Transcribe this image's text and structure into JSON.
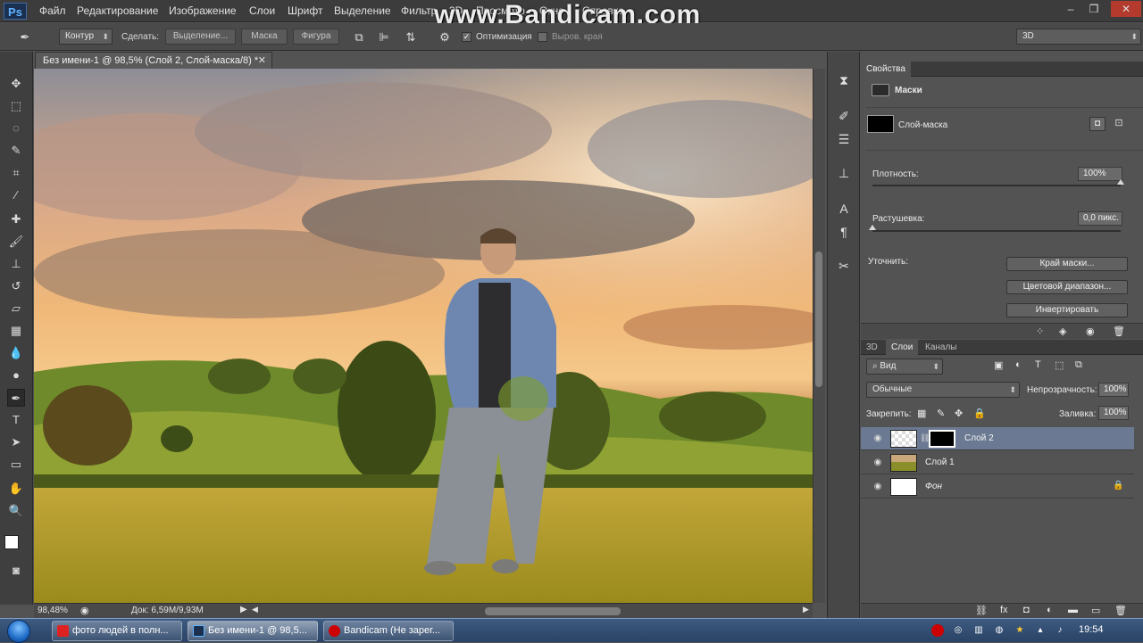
{
  "menubar": {
    "logo": "Ps",
    "items": [
      "Файл",
      "Редактирование",
      "Изображение",
      "Слои",
      "Шрифт",
      "Выделение",
      "Фильтр",
      "3D",
      "Просмотр",
      "Окно",
      "Справка"
    ],
    "watermark": "www.Bandicam.com",
    "window_controls": [
      "–",
      "❐",
      "✕"
    ]
  },
  "options": {
    "mode_dropdown": "Контур",
    "make_label": "Сделать:",
    "btn_selection": "Выделение...",
    "btn_mask": "Маска",
    "btn_shape": "Фигура",
    "optimization_label": "Оптимизация",
    "align_edges_label": "Выров. края",
    "workspace_dropdown": "3D"
  },
  "document": {
    "tab_title": "Без имени-1 @ 98,5% (Слой 2, Слой-маска/8) *",
    "zoom": "98,48%",
    "doc_size": "Док: 6,59M/9,93M"
  },
  "properties": {
    "panel_title": "Свойства",
    "section_title": "Маски",
    "mask_label": "Слой-маска",
    "density_label": "Плотность:",
    "density_value": "100%",
    "feather_label": "Растушевка:",
    "feather_value": "0,0 пикс.",
    "refine_label": "Уточнить:",
    "btn_mask_edge": "Край маски...",
    "btn_color_range": "Цветовой диапазон...",
    "btn_invert": "Инвертировать",
    "density_fraction": 1.0,
    "feather_fraction": 0.0
  },
  "layers": {
    "tabs": [
      "3D",
      "Слои",
      "Каналы"
    ],
    "active_tab": "Слои",
    "filter_dropdown": "Вид",
    "blend_mode": "Обычные",
    "opacity_label": "Непрозрачность:",
    "opacity_value": "100%",
    "lock_label": "Закрепить:",
    "fill_label": "Заливка:",
    "fill_value": "100%",
    "items": [
      {
        "name": "Слой 2",
        "selected": true
      },
      {
        "name": "Слой 1",
        "selected": false
      },
      {
        "name": "Фон",
        "selected": false
      }
    ]
  },
  "taskbar": {
    "items": [
      "фото людей в полн...",
      "Без имени-1 @ 98,5...",
      "Bandicam (Не зарег..."
    ],
    "clock": "19:54"
  },
  "colors": {
    "selected_layer": "#6b7a92",
    "panel_bg": "#535353",
    "taskbar": "#2a4366"
  },
  "icons": {
    "tools": [
      "move-icon",
      "marquee-icon",
      "lasso-icon",
      "quick-select-icon",
      "crop-icon",
      "eyedropper-icon",
      "healing-brush-icon",
      "brush-icon",
      "clone-stamp-icon",
      "history-brush-icon",
      "eraser-icon",
      "gradient-icon",
      "blur-icon",
      "dodge-icon",
      "pen-icon",
      "type-icon",
      "path-select-icon",
      "rectangle-icon",
      "hand-icon",
      "zoom-icon"
    ]
  }
}
